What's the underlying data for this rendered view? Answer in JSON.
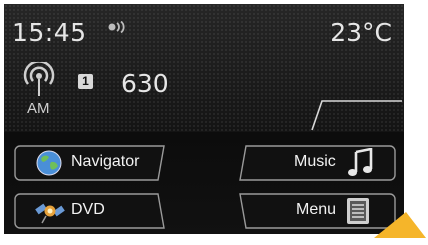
{
  "status": {
    "time": "15:45",
    "temperature": "23°C"
  },
  "radio": {
    "band": "AM",
    "preset": "1",
    "frequency": "630"
  },
  "buttons": {
    "navigator": "Navigator",
    "music": "Music",
    "dvd": "DVD",
    "menu": "Menu"
  },
  "icons": {
    "connection": "connection-status-icon",
    "radio": "radio-antenna-icon",
    "navigator": "globe-icon",
    "music": "music-note-icon",
    "dvd": "satellite-icon",
    "menu": "menu-list-icon",
    "pointer": "cursor-arrow-icon"
  },
  "colors": {
    "background": "#0e0e0e",
    "text": "#e6e6e6",
    "pointer": "#f5b52a"
  }
}
